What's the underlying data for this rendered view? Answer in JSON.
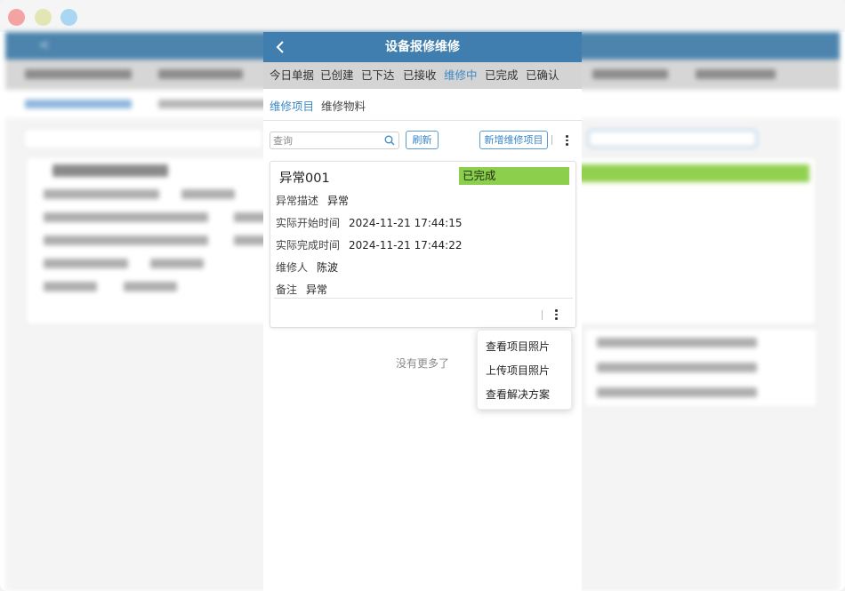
{
  "header": {
    "title": "设备报修维修",
    "back_icon": "chevron-left-icon"
  },
  "tabs": [
    {
      "label": "今日单据",
      "active": false
    },
    {
      "label": "已创建",
      "active": false
    },
    {
      "label": "已下达",
      "active": false
    },
    {
      "label": "已接收",
      "active": false
    },
    {
      "label": "维修中",
      "active": true
    },
    {
      "label": "已完成",
      "active": false
    },
    {
      "label": "已确认",
      "active": false
    }
  ],
  "sub_tabs": [
    {
      "label": "维修项目",
      "active": true
    },
    {
      "label": "维修物料",
      "active": false
    }
  ],
  "toolbar": {
    "search_placeholder": "查询",
    "refresh_label": "刷新",
    "add_label": "新增维修项目"
  },
  "card": {
    "title": "异常001",
    "status": "已完成",
    "fields": [
      {
        "label": "异常描述",
        "value": "异常"
      },
      {
        "label": "实际开始时间",
        "value": "2024-11-21 17:44:15"
      },
      {
        "label": "实际完成时间",
        "value": "2024-11-21 17:44:22"
      },
      {
        "label": "维修人",
        "value": "陈波"
      },
      {
        "label": "备注",
        "value": "异常"
      }
    ]
  },
  "no_more_text": "没有更多了",
  "menu": {
    "items": [
      {
        "label": "查看项目照片"
      },
      {
        "label": "上传项目照片"
      },
      {
        "label": "查看解决方案"
      }
    ]
  },
  "colors": {
    "header": "#3f7eae",
    "accent": "#3e88c5",
    "status_done": "#8ccf4d",
    "tab_bar": "#d4d4d4"
  }
}
